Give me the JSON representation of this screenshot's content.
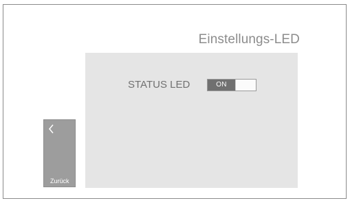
{
  "screen": {
    "title": "Einstellungs-LED"
  },
  "settings": [
    {
      "label": "STATUS LED",
      "toggle": {
        "state_label": "ON",
        "enabled": true
      }
    }
  ],
  "navigation": {
    "back_label": "Zurück",
    "back_icon": "chevron-left-icon"
  },
  "colors": {
    "toggle_on": "#707070",
    "panel_background": "#e5e5e5",
    "back_button": "#9d9d9d",
    "title_text": "#8c8c8c"
  }
}
